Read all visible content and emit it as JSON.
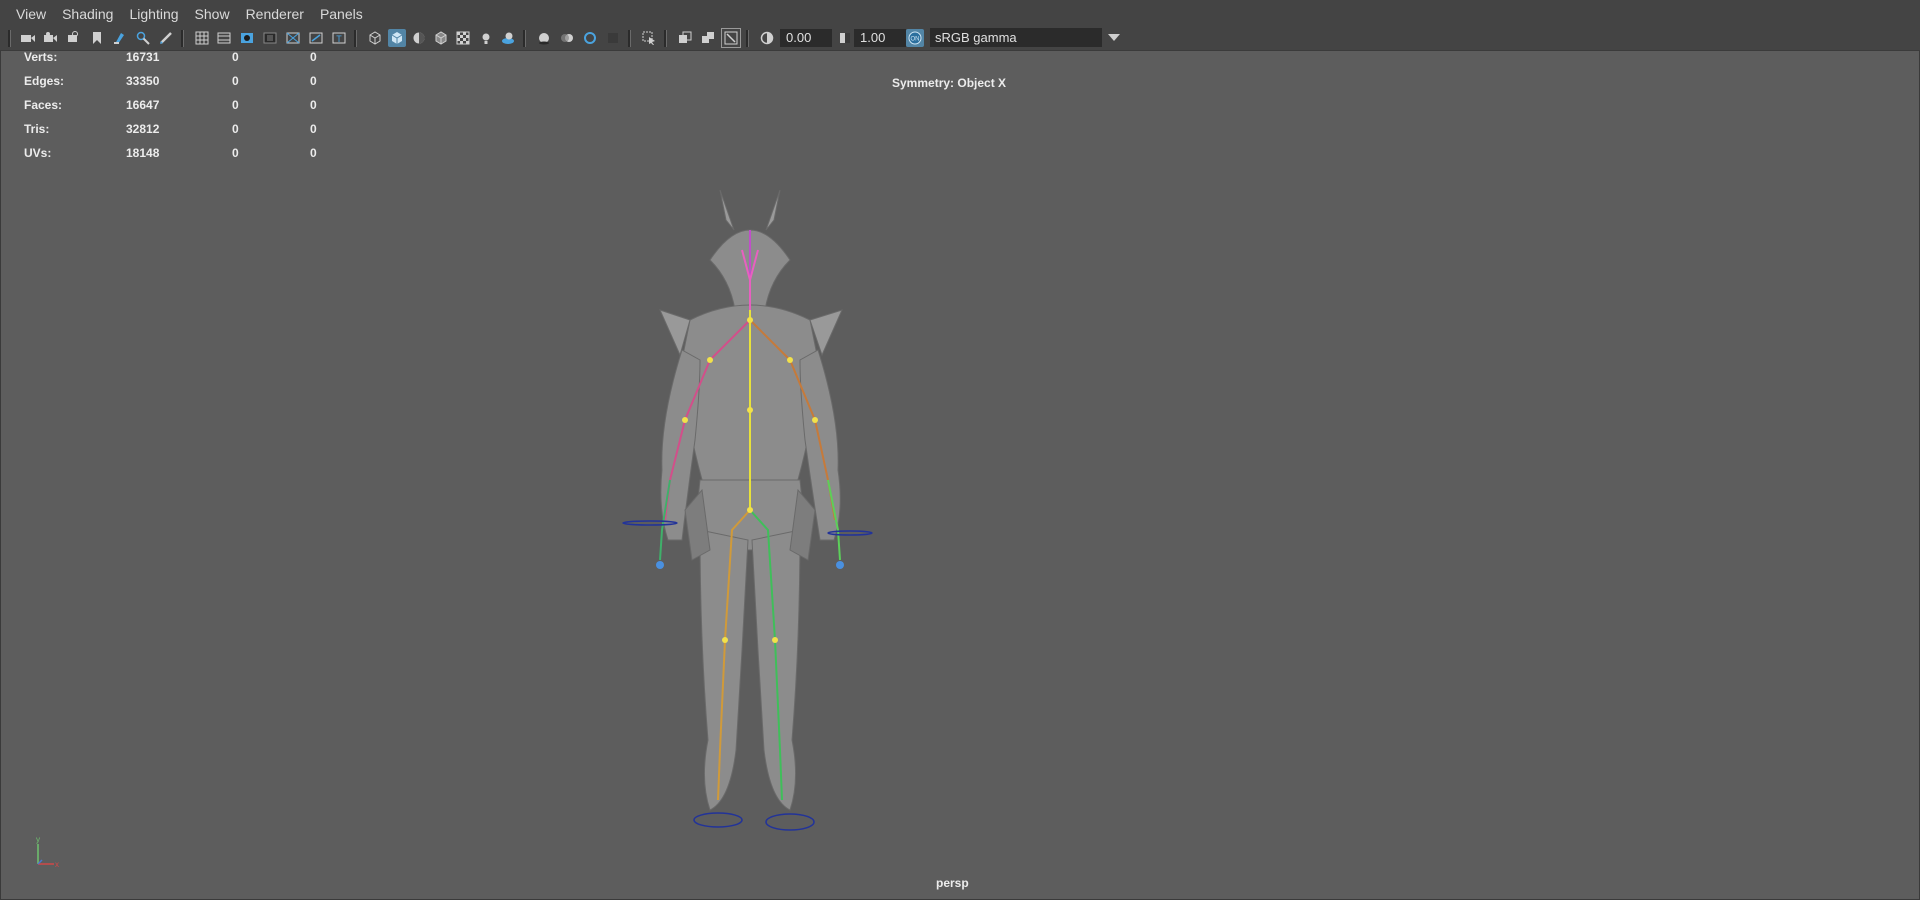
{
  "menu": [
    "View",
    "Shading",
    "Lighting",
    "Show",
    "Renderer",
    "Panels"
  ],
  "toolbar": {
    "exposure_value": "0.00",
    "gamma_value": "1.00",
    "color_space": "sRGB gamma"
  },
  "hud": {
    "stats": [
      {
        "label": "Verts:",
        "v1": "16731",
        "v2": "0",
        "v3": "0"
      },
      {
        "label": "Edges:",
        "v1": "33350",
        "v2": "0",
        "v3": "0"
      },
      {
        "label": "Faces:",
        "v1": "16647",
        "v2": "0",
        "v3": "0"
      },
      {
        "label": "Tris:",
        "v1": "32812",
        "v2": "0",
        "v3": "0"
      },
      {
        "label": "UVs:",
        "v1": "18148",
        "v2": "0",
        "v3": "0"
      }
    ],
    "symmetry": "Symmetry: Object X",
    "camera": "persp",
    "axis_y": "y",
    "axis_x": "x"
  },
  "colors": {
    "viewport_bg": "#5d5d5d",
    "toolbar_bg": "#444444",
    "active_button": "#5285a6"
  }
}
